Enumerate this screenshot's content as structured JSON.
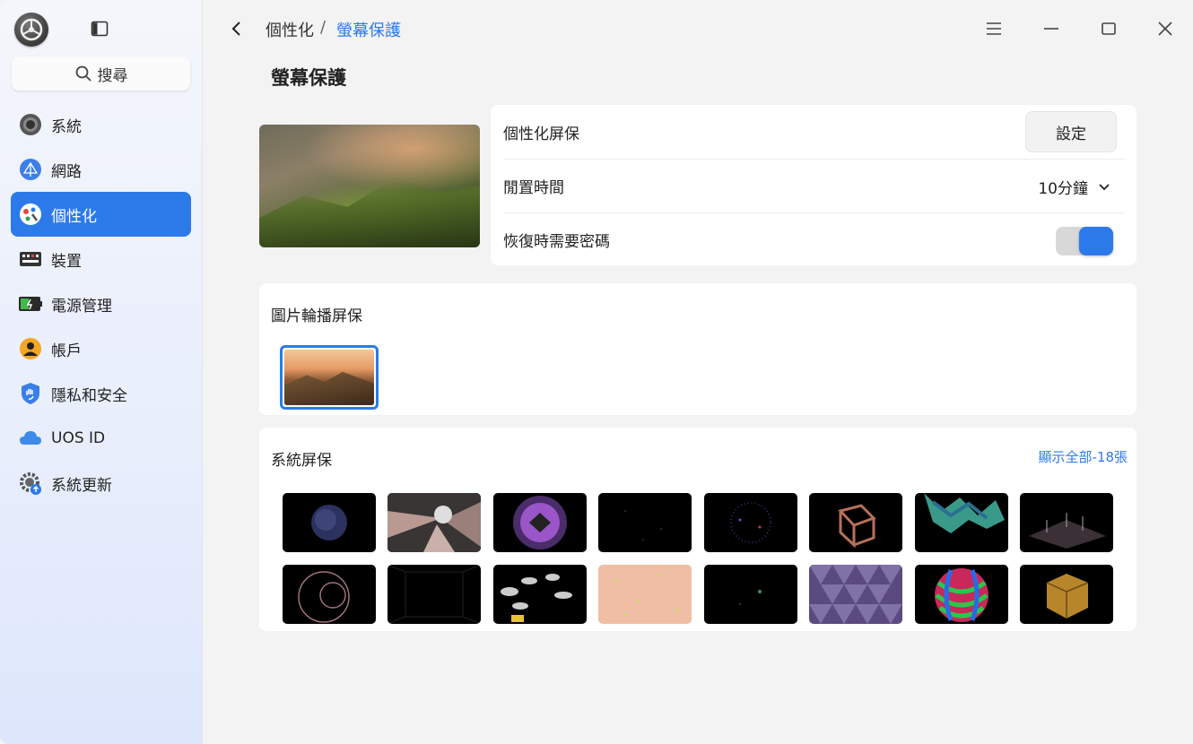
{
  "sidebar": {
    "search_label": "搜尋",
    "items": [
      {
        "label": "系統",
        "icon": "system-icon",
        "active": false
      },
      {
        "label": "網路",
        "icon": "network-icon",
        "active": false
      },
      {
        "label": "個性化",
        "icon": "personalization-icon",
        "active": true
      },
      {
        "label": "裝置",
        "icon": "device-icon",
        "active": false
      },
      {
        "label": "電源管理",
        "icon": "power-icon",
        "active": false
      },
      {
        "label": "帳戶",
        "icon": "account-icon",
        "active": false
      },
      {
        "label": "隱私和安全",
        "icon": "privacy-shield-icon",
        "active": false
      },
      {
        "label": "UOS ID",
        "icon": "cloud-icon",
        "active": false
      },
      {
        "label": "系統更新",
        "icon": "update-gear-icon",
        "active": false
      }
    ]
  },
  "header": {
    "breadcrumb_parent": "個性化",
    "breadcrumb_separator": "/",
    "breadcrumb_current": "螢幕保護"
  },
  "page_title": "螢幕保護",
  "settings": {
    "custom_label": "個性化屏保",
    "custom_button": "設定",
    "idle_label": "閒置時間",
    "idle_value": "10分鐘",
    "password_label": "恢復時需要密碼",
    "password_required": true
  },
  "slideshow": {
    "title": "圖片輪播屏保"
  },
  "system": {
    "title": "系統屏保",
    "show_all": "顯示全部-18張"
  },
  "colors": {
    "accent": "#2c7ae9"
  }
}
